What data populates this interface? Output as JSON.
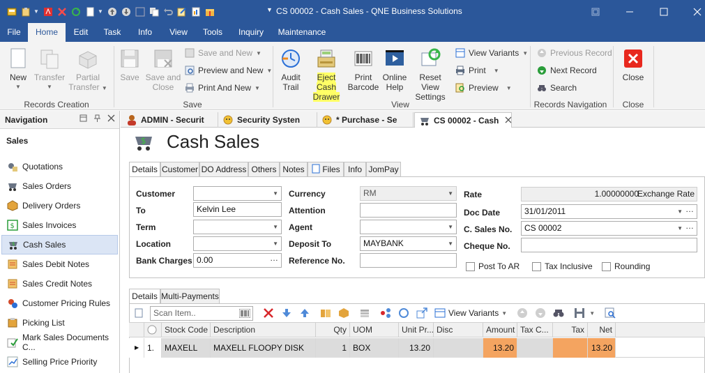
{
  "window": {
    "title": "CS 00002 - Cash Sales - QNE Business Solutions"
  },
  "ribbon_tabs": [
    "File",
    "Home",
    "Edit",
    "Task",
    "Info",
    "View",
    "Tools",
    "Inquiry",
    "Maintenance"
  ],
  "ribbon": {
    "new": "New",
    "transfer": "Transfer",
    "partial_transfer_1": "Partial",
    "partial_transfer_2": "Transfer",
    "group_records_creation": "Records Creation",
    "save": "Save",
    "save_and_close_1": "Save and",
    "save_and_close_2": "Close",
    "save_and_new": "Save and New",
    "preview_and_new": "Preview and New",
    "print_and_new": "Print And New",
    "group_save": "Save",
    "audit_trail_1": "Audit",
    "audit_trail_2": "Trail",
    "eject_1": "Eject Cash",
    "eject_2": "Drawer",
    "print_barcode_1": "Print",
    "print_barcode_2": "Barcode",
    "online_help_1": "Online",
    "online_help_2": "Help",
    "reset_view_1": "Reset View",
    "reset_view_2": "Settings",
    "view_variants": "View Variants",
    "print": "Print",
    "preview": "Preview",
    "group_view": "View",
    "previous_record": "Previous Record",
    "next_record": "Next Record",
    "search": "Search",
    "group_records_navigation": "Records Navigation",
    "close": "Close",
    "group_close": "Close"
  },
  "navigation": {
    "title": "Navigation",
    "section": "Sales",
    "items": [
      "Quotations",
      "Sales Orders",
      "Delivery Orders",
      "Sales Invoices",
      "Cash Sales",
      "Sales Debit Notes",
      "Sales Credit Notes",
      "Customer Pricing Rules",
      "Picking List",
      "Mark Sales Documents C...",
      "Selling Price Priority"
    ],
    "selected": "Cash Sales"
  },
  "doc_tabs": [
    "ADMIN - Securit",
    "Security Systen",
    "* Purchase - Se",
    "CS 00002 - Cash"
  ],
  "page_title": "Cash Sales",
  "form_tabs": [
    "Details",
    "Customer",
    "DO Address",
    "Others",
    "Notes",
    "Files",
    "Info",
    "JomPay"
  ],
  "form": {
    "customer_label": "Customer",
    "customer_value": "",
    "to_label": "To",
    "to_value": "Kelvin Lee",
    "term_label": "Term",
    "term_value": "",
    "location_label": "Location",
    "location_value": "",
    "bank_charges_label": "Bank Charges",
    "bank_charges_value": "0.00",
    "currency_label": "Currency",
    "currency_value": "RM",
    "attention_label": "Attention",
    "attention_value": "",
    "agent_label": "Agent",
    "agent_value": "",
    "deposit_to_label": "Deposit To",
    "deposit_to_value": "MAYBANK",
    "reference_no_label": "Reference No.",
    "reference_no_value": "",
    "rate_label": "Rate",
    "rate_value": "1.00000000",
    "exchange_rate": "Exchange Rate",
    "doc_date_label": "Doc Date",
    "doc_date_value": "31/01/2011",
    "c_sales_no_label": "C. Sales No.",
    "c_sales_no_value": "CS 00002",
    "cheque_no_label": "Cheque No.",
    "cheque_no_value": "",
    "post_to_ar": "Post To AR",
    "tax_inclusive": "Tax Inclusive",
    "rounding": "Rounding"
  },
  "detail_tabs": [
    "Details",
    "Multi-Payments"
  ],
  "grid_toolbar": {
    "scan_placeholder": "Scan Item..",
    "view_variants": "View Variants"
  },
  "grid": {
    "columns": [
      "Stock Code",
      "Description",
      "Qty",
      "UOM",
      "Unit Pr...",
      "Disc",
      "Amount",
      "Tax C...",
      "Tax",
      "Net"
    ],
    "rows": [
      {
        "no": "1.",
        "stock_code": "MAXELL",
        "description": "MAXELL FLOOPY DISK",
        "qty": "1",
        "uom": "BOX",
        "unit_price": "13.20",
        "disc": "",
        "amount": "13.20",
        "tax_code": "",
        "tax": "",
        "net": "13.20"
      }
    ]
  },
  "colors": {
    "brand": "#2b579a",
    "highlight": "#ffff66",
    "orange": "#f4a460",
    "nav_selected": "#dbe5f5"
  }
}
